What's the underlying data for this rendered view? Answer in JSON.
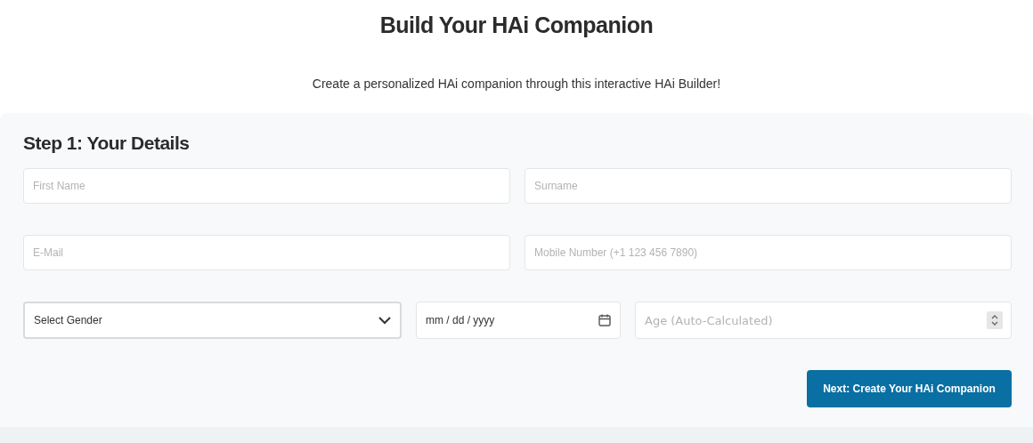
{
  "title": "Build Your HAi Companion",
  "subtitle": "Create a personalized HAi companion through this interactive HAi Builder!",
  "step": {
    "title": "Step 1: Your Details",
    "rows": [
      [
        {
          "kind": "text",
          "placeholder": "First Name"
        },
        {
          "kind": "text",
          "placeholder": "Surname"
        }
      ],
      [
        {
          "kind": "text",
          "placeholder": "E-Mail"
        },
        {
          "kind": "text",
          "placeholder": "Mobile Number (+1 123 456 7890)"
        }
      ],
      [
        {
          "kind": "select",
          "value": "Select Gender"
        },
        {
          "kind": "date",
          "value": "mm / dd / yyyy"
        },
        {
          "kind": "number",
          "placeholder": "Age (Auto-Calculated)"
        }
      ]
    ],
    "next_button": "Next: Create Your HAi Companion"
  }
}
